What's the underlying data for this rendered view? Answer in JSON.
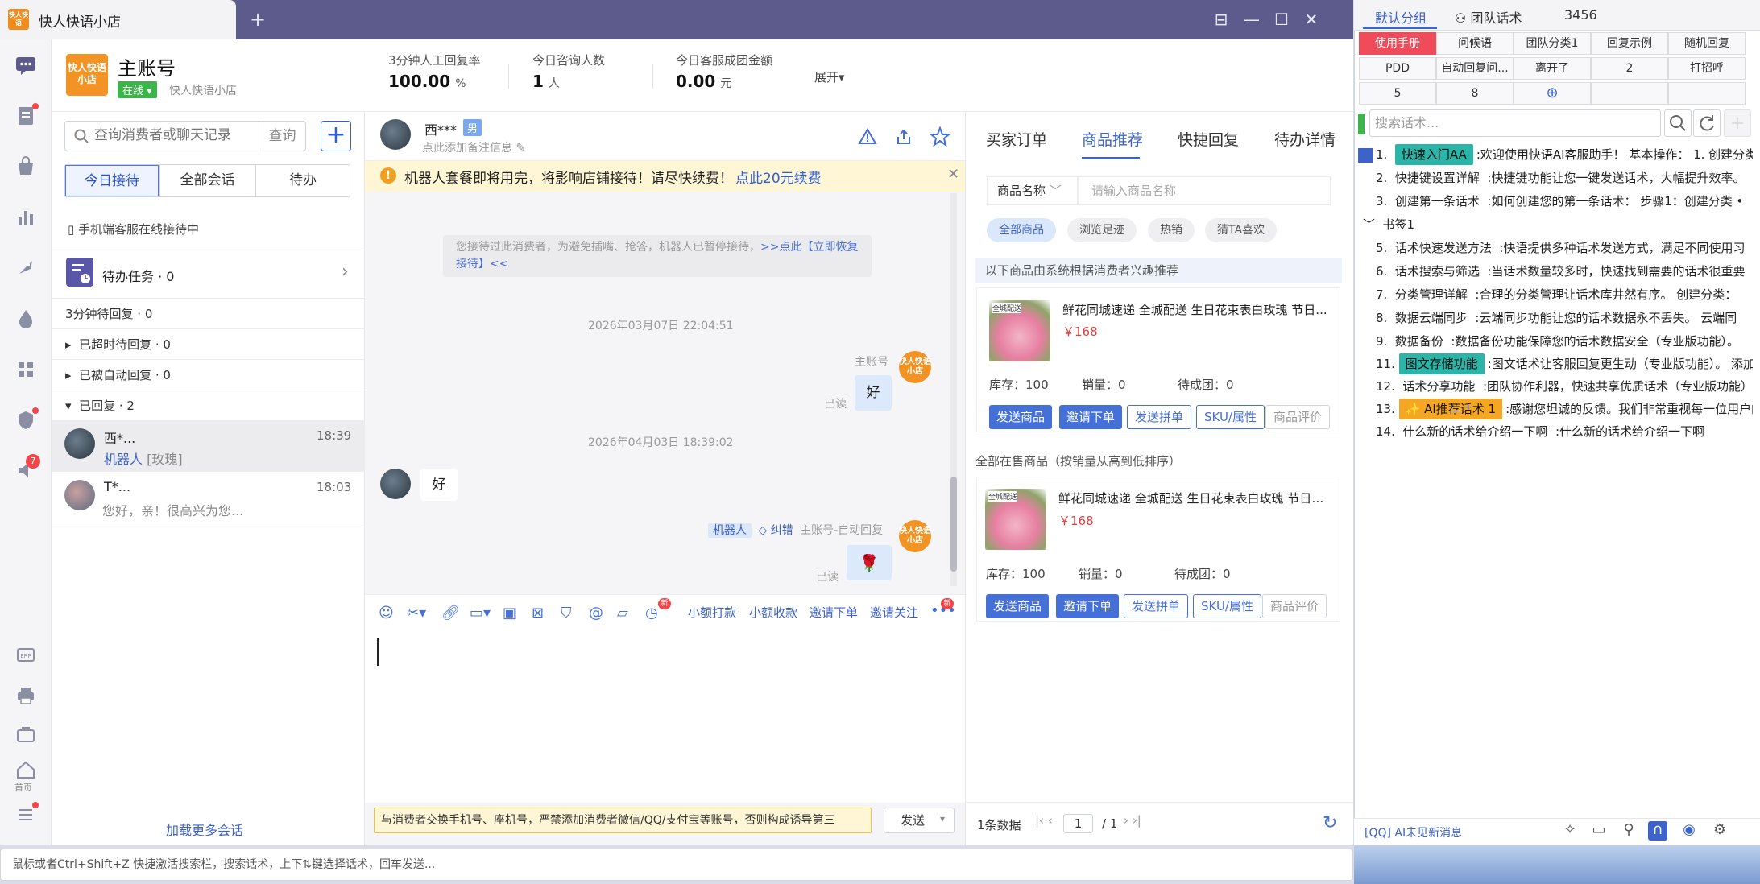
{
  "window": {
    "tab_title": "快人快语小店",
    "tab_logo": "快人快语",
    "new_tab": "+",
    "controls": [
      "⊟",
      "—",
      "☐",
      "✕"
    ]
  },
  "rail": {
    "items": [
      "chat-icon",
      "order-icon",
      "bag-icon",
      "chart-icon",
      "rocket-icon",
      "fire-icon",
      "apps-icon",
      "shield-icon",
      "speaker-icon",
      "erp-icon",
      "printer-icon",
      "briefcase-icon",
      "home-icon",
      "menu-icon"
    ],
    "badge": "7",
    "home_label": "首页",
    "erp_label": "ERP"
  },
  "header": {
    "shop_logo": "快人快语小店",
    "account_name": "主账号",
    "status": "在线",
    "shop_name": "快人快语小店",
    "stats": [
      {
        "label": "3分钟人工回复率",
        "value": "100.00",
        "unit": "%"
      },
      {
        "label": "今日咨询人数",
        "value": "1",
        "unit": "人"
      },
      {
        "label": "今日客服成团金额",
        "value": "0.00",
        "unit": "元"
      }
    ],
    "expand": "展开▾"
  },
  "conversations": {
    "search_placeholder": "查询消费者或聊天记录",
    "search_button": "查询",
    "segments": [
      "今日接待",
      "全部会话",
      "待办"
    ],
    "mobile_notice": "手机端客服在线接待中",
    "task": "待办任务 · 0",
    "groups": [
      "3分钟待回复 · 0",
      "已超时待回复 · 0",
      "已被自动回复 · 0",
      "已回复 · 2"
    ],
    "items": [
      {
        "name": "西*...",
        "time": "18:39",
        "preview_tag": "机器人",
        "preview": "[玫瑰]"
      },
      {
        "name": "T*...",
        "time": "18:03",
        "preview": "您好，亲！很高兴为您..."
      }
    ],
    "load_more": "加载更多会话"
  },
  "chat": {
    "customer_name": "西***",
    "gender": "男",
    "remark_hint": "点此添加备注信息",
    "notice": "机器人套餐即将用完，将影响店铺接待！请尽快续费！",
    "notice_link": "点此20元续费",
    "system_msg": "您接待过此消费者，为避免插嘴、抢答，机器人已暂停接待，",
    "system_link": ">>点此【立即恢复接待】<<",
    "messages": [
      {
        "time": "2026年03月07日 22:04:51"
      },
      {
        "sender": "主账号",
        "text": "好",
        "read": "已读",
        "avatar": "快人快语小店"
      },
      {
        "time": "2026年04月03日 18:39:02"
      },
      {
        "from_customer": true,
        "text": "好"
      },
      {
        "tag": "机器人",
        "correct": "纠错",
        "sender": "主账号-自动回复",
        "text": "🌹",
        "read": "已读",
        "avatar": "快人快语小店"
      }
    ],
    "toolbar_links": [
      "小额打款",
      "小额收款",
      "邀请下单",
      "邀请关注"
    ],
    "toolbar_icons": [
      "emoji-icon",
      "scissors-icon",
      "link-icon",
      "image-icon",
      "video-icon",
      "coupon-icon",
      "shield-check-icon",
      "at-icon",
      "folder-icon",
      "clock-icon"
    ],
    "more": "•••",
    "new_badge": "新",
    "warn_text": "与消费者交换手机号、座机号，严禁添加消费者微信/QQ/支付宝等账号，否则构成诱导第三",
    "send": "发送"
  },
  "products": {
    "tabs": [
      "买家订单",
      "商品推荐",
      "快捷回复",
      "待办详情"
    ],
    "filter_select": "商品名称",
    "filter_placeholder": "请输入商品名称",
    "chips": [
      "全部商品",
      "浏览足迹",
      "热销",
      "猜TA喜欢"
    ],
    "rec_header": "以下商品由系统根据消费者兴趣推荐",
    "all_header": "全部在售商品（按销量从高到低排序）",
    "items": [
      {
        "name": "鲜花同城速递 全城配送 生日花束表白玫瑰 节日...",
        "price": "￥168",
        "stock": "库存：100",
        "sales": "销量：0",
        "deals": "待成团：0",
        "img_label": "全城配送"
      },
      {
        "name": "鲜花同城速递 全城配送 生日花束表白玫瑰 节日送...",
        "price": "￥168",
        "stock": "库存：100",
        "sales": "销量：0",
        "deals": "待成团：0",
        "img_label": "全城配送"
      }
    ],
    "buttons": [
      "发送商品",
      "邀请下单",
      "发送拼单",
      "SKU/属性",
      "商品评价"
    ],
    "pager": {
      "count": "1条数据",
      "page": "1",
      "total": "/ 1"
    }
  },
  "hint_bar": "鼠标或者Ctrl+Shift+Z 快捷激活搜索栏，搜索话术，上下⇅键选择话术，回车发送...",
  "script_panel": {
    "tabs": [
      "默认分组",
      "团队话术",
      "3456"
    ],
    "cells": [
      "使用手册",
      "问候语",
      "团队分类1",
      "回复示例",
      "随机回复",
      "PDD",
      "自动回复问...",
      "离开了",
      "2",
      "打招呼",
      "5",
      "8",
      "⊕",
      "",
      ""
    ],
    "search_placeholder": "搜索话术...",
    "rows": [
      {
        "no": "1.",
        "tag": "快速入门AA",
        "text": ":欢迎使用快语AI客服助手！  基本操作：  1. 创建分类"
      },
      {
        "no": "2.",
        "title": "快捷键设置详解",
        "text": ":快捷键功能让您一键发送话术，大幅提升效率。"
      },
      {
        "no": "3.",
        "title": "创建第一条话术",
        "text": ":如何创建您的第一条话术：  步骤1：创建分类 •"
      },
      {
        "folder": "书签1"
      },
      {
        "no": "5.",
        "title": "话术快速发送方法",
        "text": ":快语提供多种话术发送方式，满足不同使用习"
      },
      {
        "no": "6.",
        "title": "话术搜索与筛选",
        "text": ":当话术数量较多时，快速找到需要的话术很重要"
      },
      {
        "no": "7.",
        "title": "分类管理详解",
        "text": ":合理的分类管理让话术库井然有序。  创建分类："
      },
      {
        "no": "8.",
        "title": "数据云端同步",
        "text": ":云端同步功能让您的话术数据永不丢失。  云端同"
      },
      {
        "no": "9.",
        "title": "数据备份",
        "text": ":数据备份功能保障您的话术数据安全（专业版功能）。"
      },
      {
        "no": "11.",
        "tag": "图文存储功能",
        "text": ":图文话术让客服回复更生动（专业版功能）。  添加"
      },
      {
        "no": "12.",
        "title": "话术分享功能",
        "text": ":团队协作利器，快速共享优质话术（专业版功能）"
      },
      {
        "no": "13.",
        "tag": "✨ AI推荐话术 1",
        "text": ":感谢您坦诚的反馈。我们非常重视每一位用户的"
      },
      {
        "no": "14.",
        "title": "什么新的话术给介绍一下啊",
        "text": ":什么新的话术给介绍一下啊"
      }
    ],
    "footer_text": "[QQ] AI未见新消息",
    "footer_icons": [
      "sparkle-icon",
      "folder-icon",
      "pin-icon",
      "magnet-icon",
      "message-icon",
      "settings-icon"
    ]
  },
  "colors": {
    "accent": "#3d63c8",
    "titlebar": "#5d5a8c",
    "danger": "#f04b5a",
    "teal": "#2ab5a8",
    "orange": "#f39323"
  }
}
